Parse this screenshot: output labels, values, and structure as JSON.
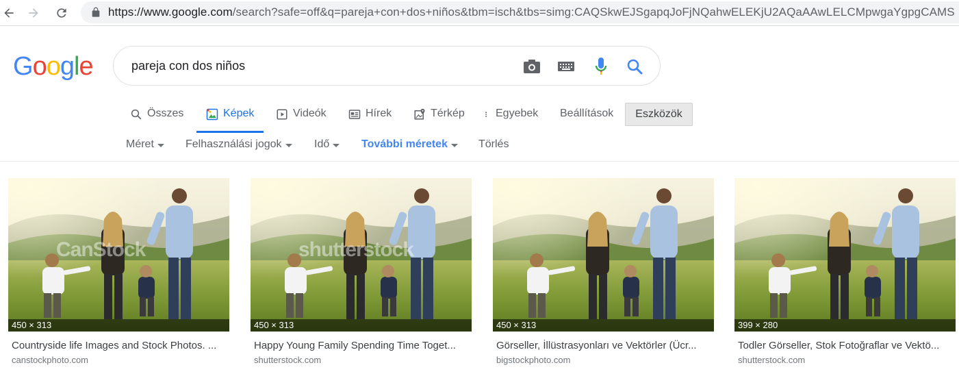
{
  "browser": {
    "url_host": "https://www.google.com",
    "url_rest": "/search?safe=off&q=pareja+con+dos+niños&tbm=isch&tbs=simg:CAQSkwEJSgapqJoFjNQahwELEKjU2AQaAAwLELCMpwgaYgpgCAMS"
  },
  "logo": [
    "G",
    "o",
    "o",
    "g",
    "l",
    "e"
  ],
  "logo_colors": [
    "#4285f4",
    "#ea4335",
    "#fbbc05",
    "#4285f4",
    "#34a853",
    "#ea4335"
  ],
  "search": {
    "query": "pareja con dos niños"
  },
  "tabs": [
    {
      "label": "Összes",
      "icon": "search-icon"
    },
    {
      "label": "Képek",
      "icon": "image-icon",
      "active": true
    },
    {
      "label": "Videók",
      "icon": "play-icon"
    },
    {
      "label": "Hírek",
      "icon": "news-icon"
    },
    {
      "label": "Térkép",
      "icon": "map-icon"
    },
    {
      "label": "Egyebek",
      "icon": "more-vert-icon"
    },
    {
      "label": "Beállítások"
    }
  ],
  "tools_label": "Eszközök",
  "filters": [
    {
      "label": "Méret"
    },
    {
      "label": "Felhasználási jogok"
    },
    {
      "label": "Idő"
    },
    {
      "label": "További méretek"
    },
    {
      "label": "Törlés"
    }
  ],
  "results": [
    {
      "dims": "450 × 313",
      "title": "Countryside life Images and Stock Photos. ...",
      "site": "canstockphoto.com",
      "watermark": "CanStock"
    },
    {
      "dims": "450 × 313",
      "title": "Happy Young Family Spending Time Toget...",
      "site": "shutterstock.com",
      "watermark": "shutterstock"
    },
    {
      "dims": "450 × 313",
      "title": "Görseller, İllüstrasyonları ve Vektörler (Ücr...",
      "site": "bigstockphoto.com",
      "watermark": ""
    },
    {
      "dims": "399 × 280",
      "title": "Todler Görseller, Stok Fotoğraflar ve Vektö...",
      "site": "shutterstock.com",
      "watermark": ""
    }
  ]
}
